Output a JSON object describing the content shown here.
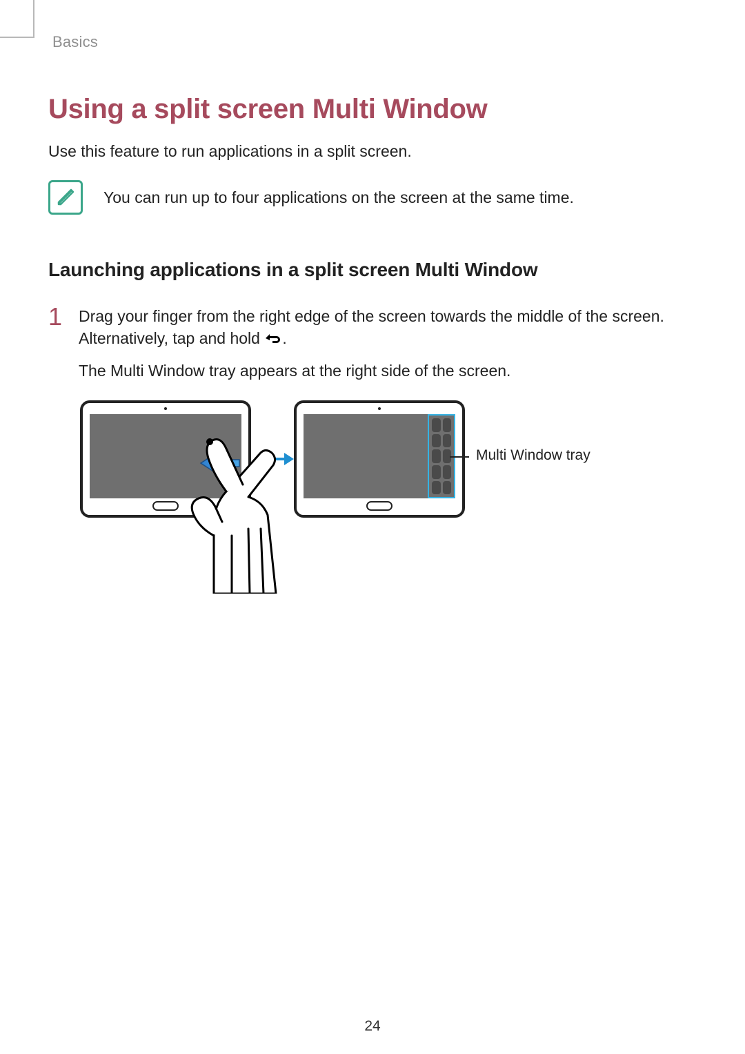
{
  "header": {
    "section": "Basics"
  },
  "title": "Using a split screen Multi Window",
  "intro": "Use this feature to run applications in a split screen.",
  "note": {
    "text": "You can run up to four applications on the screen at the same time."
  },
  "subheading": "Launching applications in a split screen Multi Window",
  "step1": {
    "number": "1",
    "para_a_before_icon": "Drag your finger from the right edge of the screen towards the middle of the screen. Alternatively, tap and hold ",
    "para_a_after_icon": ".",
    "para_b": "The Multi Window tray appears at the right side of the screen."
  },
  "figure": {
    "callout": "Multi Window tray"
  },
  "page_number": "24"
}
